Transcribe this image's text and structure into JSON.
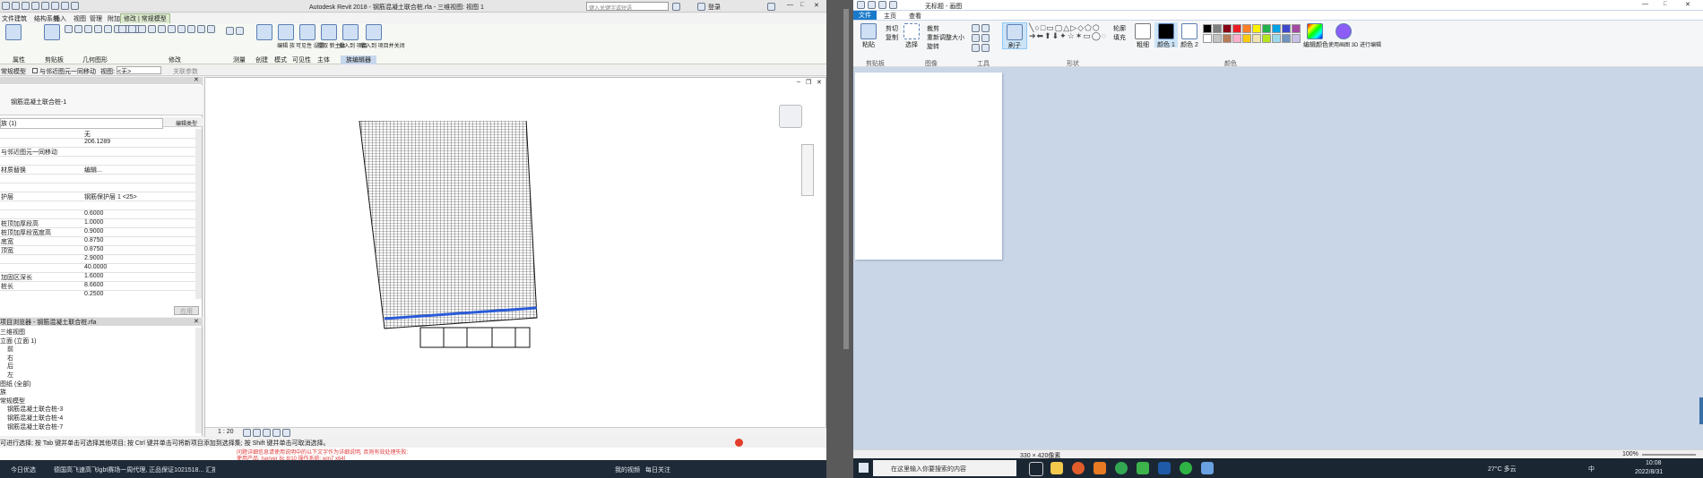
{
  "revit": {
    "title": "Autodesk Revit 2018 -    钢筋混凝土联合桩.rfa - 三维视图: 视图 1",
    "search_placeholder": "键入关键字或短语",
    "user": "登录",
    "menu_tabs": [
      "文件",
      "建筑",
      "结构",
      "系统",
      "插入",
      "注释",
      "视图",
      "管理",
      "附加模块",
      "修改",
      "常规模型"
    ],
    "active_tab": "修改 | 常规模型",
    "ribbon_groups": [
      "属性",
      "剪贴板",
      "几何图形",
      "修改",
      "测量",
      "创建",
      "模式",
      "可见性",
      "主体",
      "族编辑器"
    ],
    "ribbon_buttons": [
      "编辑\n族",
      "可见性\n设置",
      "拾取\n新主体",
      "载入到\n项目",
      "载入到\n项目并关闭"
    ],
    "options_bar": {
      "label": "常规模型",
      "check_label": "与邻近图元一同移动",
      "view_label": "视图:",
      "view_value": "<无>",
      "extra": "关联参数"
    },
    "properties": {
      "type_name": "钢筋混凝土联合桩-1",
      "instance_selector": "族 (1)",
      "edit_type": "编辑类型",
      "rows": [
        {
          "k": "",
          "v": "无"
        },
        {
          "k": "",
          "v": "206.1289"
        },
        {
          "k": "与邻近图元一同移动",
          "v": ""
        },
        {
          "k": "",
          "v": ""
        },
        {
          "k": "材质替换",
          "v": "编辑..."
        },
        {
          "k": "",
          "v": ""
        },
        {
          "k": "",
          "v": ""
        },
        {
          "k": "护层",
          "v": "钢筋保护层 1 <25>"
        },
        {
          "k": "",
          "v": ""
        },
        {
          "k": "",
          "v": "0.6000"
        },
        {
          "k": "桩顶加厚段高",
          "v": "1.0000"
        },
        {
          "k": "桩顶加厚段宽度高",
          "v": "0.9000"
        },
        {
          "k": "底宽",
          "v": "0.8750"
        },
        {
          "k": "顶宽",
          "v": "0.8750"
        },
        {
          "k": "",
          "v": "2.9000"
        },
        {
          "k": "",
          "v": "40.0000"
        },
        {
          "k": "加固区深长",
          "v": "1.6000"
        },
        {
          "k": "桩长",
          "v": "8.6600"
        },
        {
          "k": "",
          "v": "0.2500"
        }
      ],
      "apply": "应用"
    },
    "browser": {
      "title": "项目浏览器 - 钢筋混凝土联合桩.rfa",
      "items": [
        "三维视图",
        "立面 (立面 1)",
        "前",
        "右",
        "后",
        "左",
        "图纸 (全部)",
        "族",
        "常规模型",
        "钢筋混凝土联合桩-3",
        "钢筋混凝土联合桩-4",
        "钢筋混凝土联合桩-7"
      ]
    },
    "view_scale": "1 : 20",
    "status_text": "可进行选择; 按 Tab 键并单击可选择其他项目; 按 Ctrl 键并单击可将新项目添加到选择集; 按 Shift 键并单击可取消选择。",
    "warning_lines": [
      "问题详细信息请使用说明中的以下文字作为详细说明, 否则有效处理失败:",
      "使用产品: [server 8c 8/10 操作系统: win7 x64]"
    ],
    "taskbar_left": "今日优选",
    "taskbar_news": "德国高飞速高飞lgbt赛场一周代理, 正品保证1021518... 汇报",
    "taskbar_right": [
      "我的视频",
      "每日关注"
    ]
  },
  "paint": {
    "title": "无标题 - 画图",
    "tabs": [
      "文件",
      "主页",
      "查看"
    ],
    "groups": [
      "剪贴板",
      "图像",
      "工具",
      "形状",
      "颜色"
    ],
    "clipboard": [
      "粘贴",
      "剪切",
      "复制"
    ],
    "image": [
      "选择",
      "裁剪",
      "重新调整大小",
      "旋转"
    ],
    "brush": "刷子",
    "outline": "轮廓",
    "fill": "填充",
    "size": "粗细",
    "color1": "颜色 1",
    "color2": "颜色 2",
    "edit_colors": "编辑颜色",
    "paint3d": "使用画图 3D 进行编辑",
    "canvas_size": "330 × 420像素",
    "zoom": "100%",
    "palette": [
      "#000000",
      "#7f7f7f",
      "#880015",
      "#ed1c24",
      "#ff7f27",
      "#fff200",
      "#22b14c",
      "#00a2e8",
      "#3f48cc",
      "#a349a4",
      "#ffffff",
      "#c3c3c3",
      "#b97a57",
      "#ffaec9",
      "#ffc90e",
      "#efe4b0",
      "#b5e61d",
      "#99d9ea",
      "#7092be",
      "#c8bfe7"
    ]
  },
  "taskbar": {
    "search_placeholder": "在这里输入你要搜索的内容",
    "weather": "27°C 多云",
    "time": "10:08",
    "date": "2022/8/31",
    "lang": "中"
  }
}
